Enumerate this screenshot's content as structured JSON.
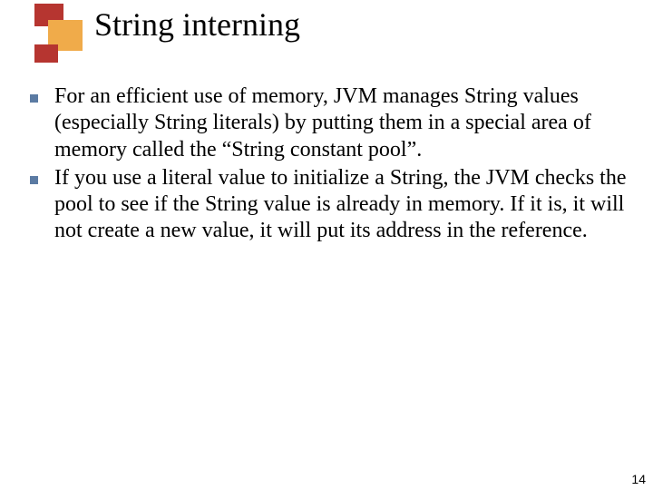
{
  "title": "String interning",
  "bullets": [
    "For an efficient use of memory, JVM manages String values (especially String literals) by putting them in a special area of memory called the “String constant pool”.",
    "If you use a literal value to initialize a String, the JVM checks the pool to see if the String value is already in memory. If it is, it will not create a new value, it will put its address in the reference."
  ],
  "page_number": "14"
}
